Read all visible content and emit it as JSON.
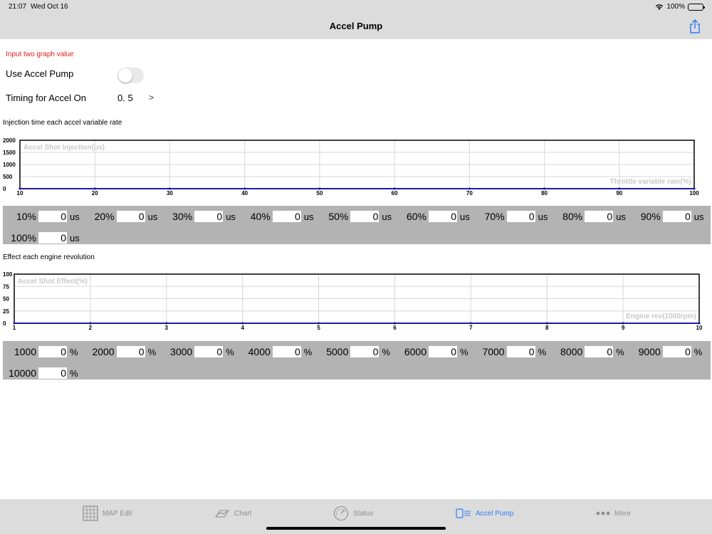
{
  "status_bar": {
    "time": "21:07",
    "date": "Wed Oct 16",
    "battery": "100%"
  },
  "nav": {
    "title": "Accel Pump",
    "share_icon": "share-icon"
  },
  "form": {
    "hint": "Input two graph value",
    "use_accel_pump_label": "Use Accel Pump",
    "use_accel_pump_on": false,
    "timing_label": "Timing for Accel On",
    "timing_value": "0. 5",
    "timing_chevron": ">"
  },
  "injection_section": {
    "title": "Injection time each accel variable rate",
    "cells": [
      {
        "label": "10%",
        "value": "0",
        "unit": "us"
      },
      {
        "label": "20%",
        "value": "0",
        "unit": "us"
      },
      {
        "label": "30%",
        "value": "0",
        "unit": "us"
      },
      {
        "label": "40%",
        "value": "0",
        "unit": "us"
      },
      {
        "label": "50%",
        "value": "0",
        "unit": "us"
      },
      {
        "label": "60%",
        "value": "0",
        "unit": "us"
      },
      {
        "label": "70%",
        "value": "0",
        "unit": "us"
      },
      {
        "label": "80%",
        "value": "0",
        "unit": "us"
      },
      {
        "label": "90%",
        "value": "0",
        "unit": "us"
      },
      {
        "label": "100%",
        "value": "0",
        "unit": "us"
      }
    ]
  },
  "effect_section": {
    "title": "Effect each engine revolution",
    "cells": [
      {
        "label": "1000",
        "value": "0",
        "unit": "%"
      },
      {
        "label": "2000",
        "value": "0",
        "unit": "%"
      },
      {
        "label": "3000",
        "value": "0",
        "unit": "%"
      },
      {
        "label": "4000",
        "value": "0",
        "unit": "%"
      },
      {
        "label": "5000",
        "value": "0",
        "unit": "%"
      },
      {
        "label": "6000",
        "value": "0",
        "unit": "%"
      },
      {
        "label": "7000",
        "value": "0",
        "unit": "%"
      },
      {
        "label": "8000",
        "value": "0",
        "unit": "%"
      },
      {
        "label": "9000",
        "value": "0",
        "unit": "%"
      },
      {
        "label": "10000",
        "value": "0",
        "unit": "%"
      }
    ]
  },
  "chart_data": [
    {
      "type": "line",
      "title": "",
      "ylabel": "Accel Shot Injection(us)",
      "xlabel": "Throttle variable rate(%)",
      "x": [
        10,
        20,
        30,
        40,
        50,
        60,
        70,
        80,
        90,
        100
      ],
      "xticks": [
        "10",
        "20",
        "30",
        "40",
        "50",
        "60",
        "70",
        "80",
        "90",
        "100"
      ],
      "yticks": [
        "0",
        "500",
        "1000",
        "1500",
        "2000"
      ],
      "xlim": [
        10,
        100
      ],
      "ylim": [
        0,
        2000
      ],
      "grid": true,
      "series": [
        {
          "values": [
            0,
            0,
            0,
            0,
            0,
            0,
            0,
            0,
            0,
            0
          ],
          "color": "#1c1ca8"
        }
      ]
    },
    {
      "type": "line",
      "title": "",
      "ylabel": "Accel Shot Effect(%)",
      "xlabel": "Engine rev(1000rpm)",
      "x": [
        1,
        2,
        3,
        4,
        5,
        6,
        7,
        8,
        9,
        10
      ],
      "xticks": [
        "1",
        "2",
        "3",
        "4",
        "5",
        "6",
        "7",
        "8",
        "9",
        "10"
      ],
      "yticks": [
        "0",
        "25",
        "50",
        "75",
        "100"
      ],
      "xlim": [
        1,
        10
      ],
      "ylim": [
        0,
        100
      ],
      "grid": true,
      "series": [
        {
          "values": [
            0,
            0,
            0,
            0,
            0,
            0,
            0,
            0,
            0,
            0
          ],
          "color": "#1c1ca8"
        }
      ]
    }
  ],
  "tab_bar": {
    "tabs": [
      {
        "label": "MAP Edit",
        "icon": "grid-icon",
        "active": false
      },
      {
        "label": "Chart",
        "icon": "chart-icon",
        "active": false
      },
      {
        "label": "Status",
        "icon": "gauge-icon",
        "active": false
      },
      {
        "label": "Accel Pump",
        "icon": "pump-icon",
        "active": true
      },
      {
        "label": "More",
        "icon": "more-icon",
        "active": false
      }
    ]
  },
  "colors": {
    "accent": "#2f7cf6",
    "hint": "#e0201a",
    "panel": "#b3b3b3",
    "bar": "#dcdcdc",
    "plot_line": "#1c1ca8"
  }
}
